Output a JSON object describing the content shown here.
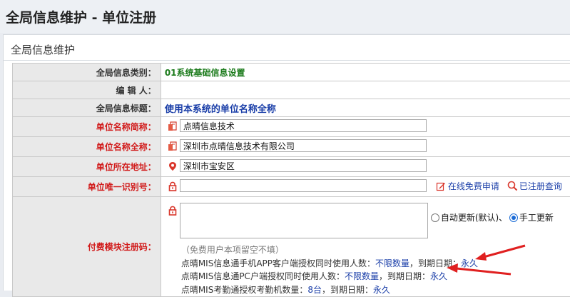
{
  "page": {
    "title": "全局信息维护 - 单位注册"
  },
  "panel": {
    "title": "全局信息维护"
  },
  "form": {
    "category": {
      "label": "全局信息类别：",
      "value": "01系统基础信息设置"
    },
    "editor": {
      "label": "编 辑 人：",
      "value": ""
    },
    "info_title": {
      "label": "全局信息标题：",
      "value": "使用本系统的单位名称全称"
    },
    "short_name": {
      "label": "单位名称简称：",
      "value": "点晴信息技术"
    },
    "full_name": {
      "label": "单位名称全称：",
      "value": "深圳市点晴信息技术有限公司"
    },
    "address": {
      "label": "单位所在地址：",
      "value": "深圳市宝安区"
    },
    "unique_id": {
      "label": "单位唯一识别号：",
      "value": "",
      "apply_link": "在线免费申请",
      "query_link": "已注册查询"
    },
    "reg_code": {
      "label": "付费模块注册码：",
      "value": "",
      "radio_auto": "自动更新(默认)、",
      "radio_manual": "手工更新",
      "selected": "manual",
      "note": "（免费用户本项留空不填）",
      "lines": [
        {
          "pre": "点晴MIS信息通手机APP客户端授权同时使用人数：",
          "v1": "不限数量",
          "mid": "，到期日期：",
          "v2": "永久"
        },
        {
          "pre": "点晴MIS信息通PC户端授权同时使用人数：",
          "v1": "不限数量",
          "mid": "，到期日期：",
          "v2": "永久"
        },
        {
          "pre": "点晴MIS考勤通授权考勤机数量：",
          "v1": "8台",
          "mid": "，到期日期：",
          "v2": "永久"
        }
      ]
    }
  },
  "colors": {
    "label_red": "#d11a1a",
    "value_blue": "#1a3ea8",
    "value_green": "#1a7a1a",
    "arrow_red": "#e02020"
  }
}
